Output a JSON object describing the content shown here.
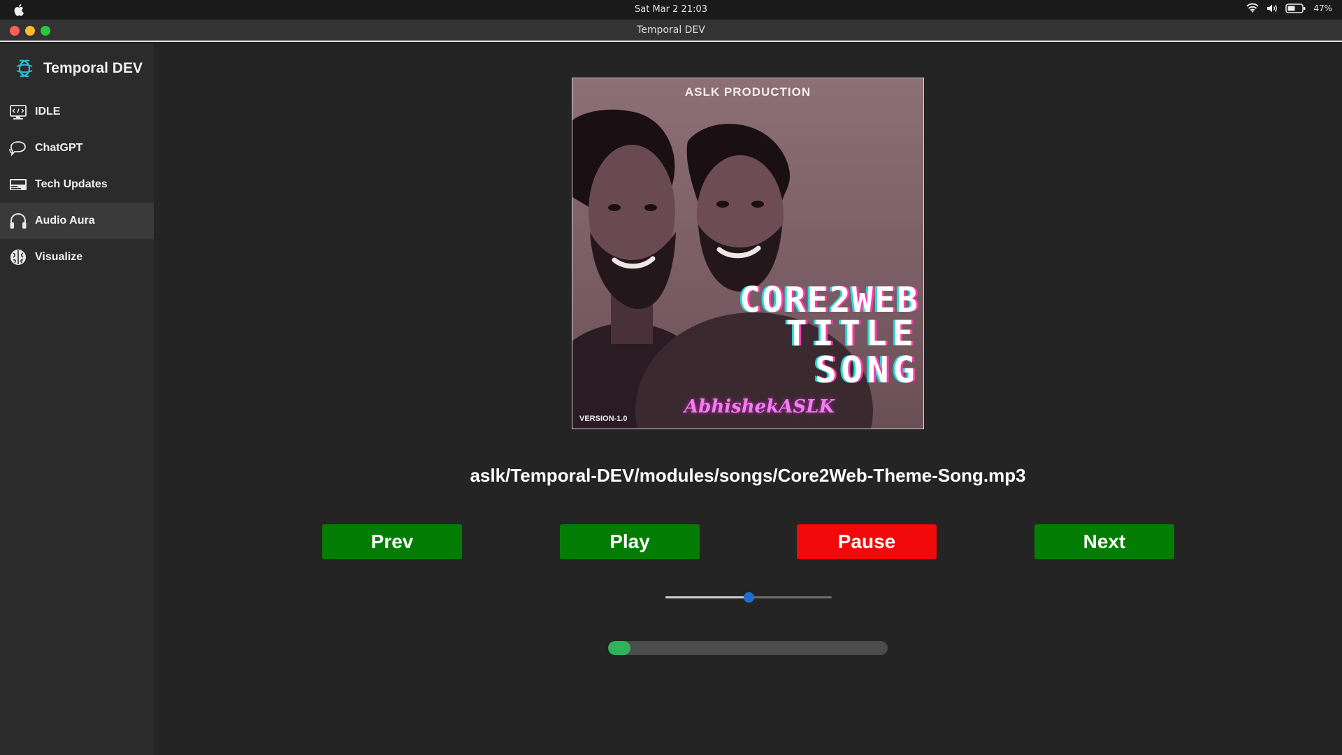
{
  "menubar": {
    "clock": "Sat Mar 2  21:03",
    "battery_percent": "47%",
    "icons": [
      "apple-icon",
      "wifi-icon",
      "volume-icon",
      "battery-icon"
    ]
  },
  "window": {
    "title": "Temporal DEV"
  },
  "sidebar": {
    "brand": "Temporal DEV",
    "items": [
      {
        "label": "IDLE",
        "icon": "code-monitor-icon",
        "active": false
      },
      {
        "label": "ChatGPT",
        "icon": "chat-bubbles-icon",
        "active": false
      },
      {
        "label": "Tech Updates",
        "icon": "news-icon",
        "active": false
      },
      {
        "label": "Audio Aura",
        "icon": "headphones-icon",
        "active": true
      },
      {
        "label": "Visualize",
        "icon": "brain-icon",
        "active": false
      }
    ]
  },
  "player": {
    "cover": {
      "heading": "ASLK PRODUCTION",
      "title_line1": "CORE2WEB",
      "title_line2": "TITLE",
      "title_line3": "SONG",
      "artist": "AbhishekASLK",
      "version": "VERSION-1.0"
    },
    "song_path": "aslk/Temporal-DEV/modules/songs/Core2Web-Theme-Song.mp3",
    "buttons": {
      "prev": "Prev",
      "play": "Play",
      "pause": "Pause",
      "next": "Next"
    },
    "volume_fraction": 0.5,
    "progress_fraction": 0.08
  },
  "colors": {
    "play_green": "#047d04",
    "pause_red": "#f20909",
    "slider_knob": "#1f6fcf",
    "progress_green": "#2fb35a"
  }
}
